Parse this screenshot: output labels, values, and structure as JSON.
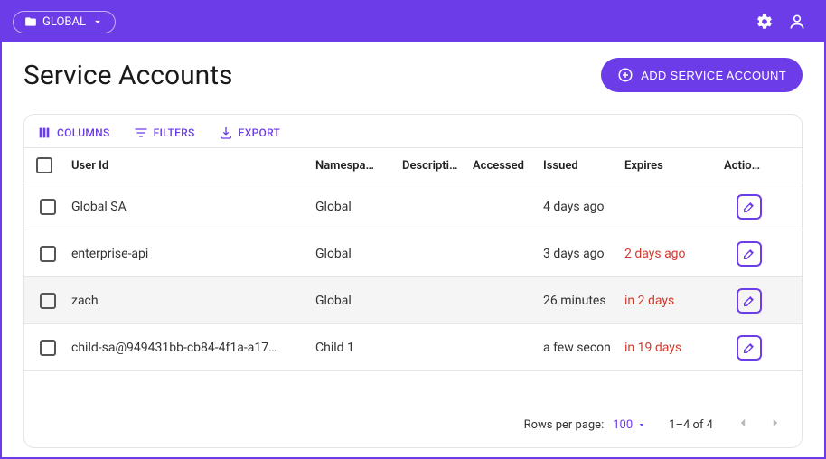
{
  "topbar": {
    "namespace": "GLOBAL"
  },
  "page": {
    "title": "Service Accounts",
    "add_button": "ADD SERVICE ACCOUNT"
  },
  "toolbar": {
    "columns": "COLUMNS",
    "filters": "FILTERS",
    "export": "EXPORT"
  },
  "table": {
    "headers": {
      "user_id": "User Id",
      "namespace": "Namespa…",
      "description": "Descripti…",
      "accessed": "Accessed",
      "issued": "Issued",
      "expires": "Expires",
      "actions": "Actions"
    },
    "rows": [
      {
        "user_id": "Global SA",
        "namespace": "Global",
        "description": "",
        "accessed": "",
        "issued": "4 days ago",
        "expires": "",
        "expires_warn": false,
        "hover": false
      },
      {
        "user_id": "enterprise-api",
        "namespace": "Global",
        "description": "",
        "accessed": "",
        "issued": "3 days ago",
        "expires": "2 days ago",
        "expires_warn": true,
        "hover": false
      },
      {
        "user_id": "zach",
        "namespace": "Global",
        "description": "",
        "accessed": "",
        "issued": "26 minutes",
        "expires": "in 2 days",
        "expires_warn": true,
        "hover": true
      },
      {
        "user_id": "child-sa@949431bb-cb84-4f1a-a17…",
        "namespace": "Child 1",
        "description": "",
        "accessed": "",
        "issued": "a few secon",
        "expires": "in 19 days",
        "expires_warn": true,
        "hover": false
      }
    ]
  },
  "footer": {
    "rpp_label": "Rows per page:",
    "rpp_value": "100",
    "range": "1–4 of 4"
  }
}
